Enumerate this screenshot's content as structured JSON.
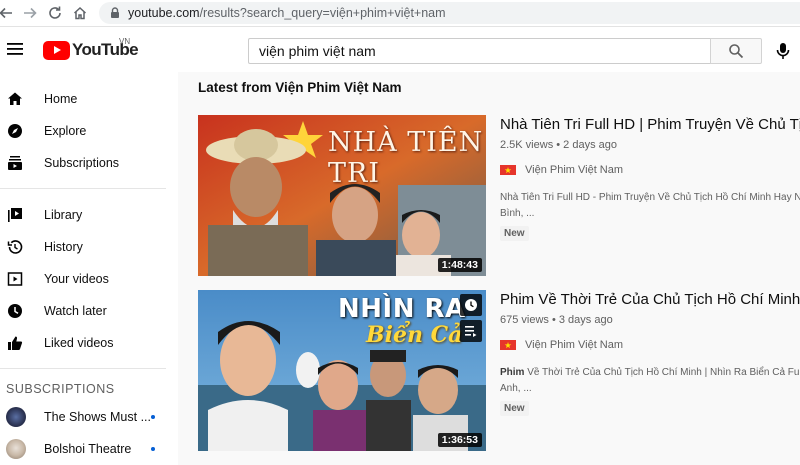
{
  "browser": {
    "url_host": "youtube.com",
    "url_path": "/results?search_query=viện+phim+việt+nam"
  },
  "masthead": {
    "logo_text": "YouTube",
    "country_code": "VN",
    "search_value": "viện phim việt nam"
  },
  "sidebar": {
    "items": [
      {
        "label": "Home",
        "icon": "home-icon"
      },
      {
        "label": "Explore",
        "icon": "explore-icon"
      },
      {
        "label": "Subscriptions",
        "icon": "subscriptions-icon"
      },
      {
        "label": "Library",
        "icon": "library-icon"
      },
      {
        "label": "History",
        "icon": "history-icon"
      },
      {
        "label": "Your videos",
        "icon": "your-videos-icon"
      },
      {
        "label": "Watch later",
        "icon": "watch-later-icon"
      },
      {
        "label": "Liked videos",
        "icon": "thumbs-up-icon"
      }
    ],
    "subscriptions_header": "SUBSCRIPTIONS",
    "subscriptions": [
      {
        "label": "The Shows Must ..."
      },
      {
        "label": "Bolshoi Theatre"
      }
    ]
  },
  "main": {
    "section_title": "Latest from Viện Phim Việt Nam",
    "videos": [
      {
        "title": "Nhà Tiên Tri Full HD | Phim Truyện Về Chủ Tịch Hồ",
        "meta": "2.5K views • 2 days ago",
        "channel": "Viện Phim Việt Nam",
        "desc_line1": "Nhà Tiên Tri Full HD - Phim Truyện Về Chủ Tịch Hồ Chí Minh Hay Nhất",
        "desc_line2": "Bình, ...",
        "badge": "New",
        "duration": "1:48:43",
        "thumb_text": "NHÀ TIÊN TRI"
      },
      {
        "title": "Phim Về Thời Trẻ Của Chủ Tịch Hồ Chí Minh | Nhìn",
        "meta": "675 views • 3 days ago",
        "channel": "Viện Phim Việt Nam",
        "desc_line1_bold": "Phim",
        "desc_line1_rest": " Về Thời Trẻ Của Chủ Tịch Hồ Chí Minh | Nhìn Ra Biển Cả Full HD",
        "desc_line2": "Anh, ...",
        "badge": "New",
        "duration": "1:36:53",
        "thumb_text_1": "NHÌN RA",
        "thumb_text_2": "Biển Cả"
      }
    ]
  },
  "colors": {
    "brand_red": "#ff0000",
    "link_blue": "#065fd4"
  }
}
